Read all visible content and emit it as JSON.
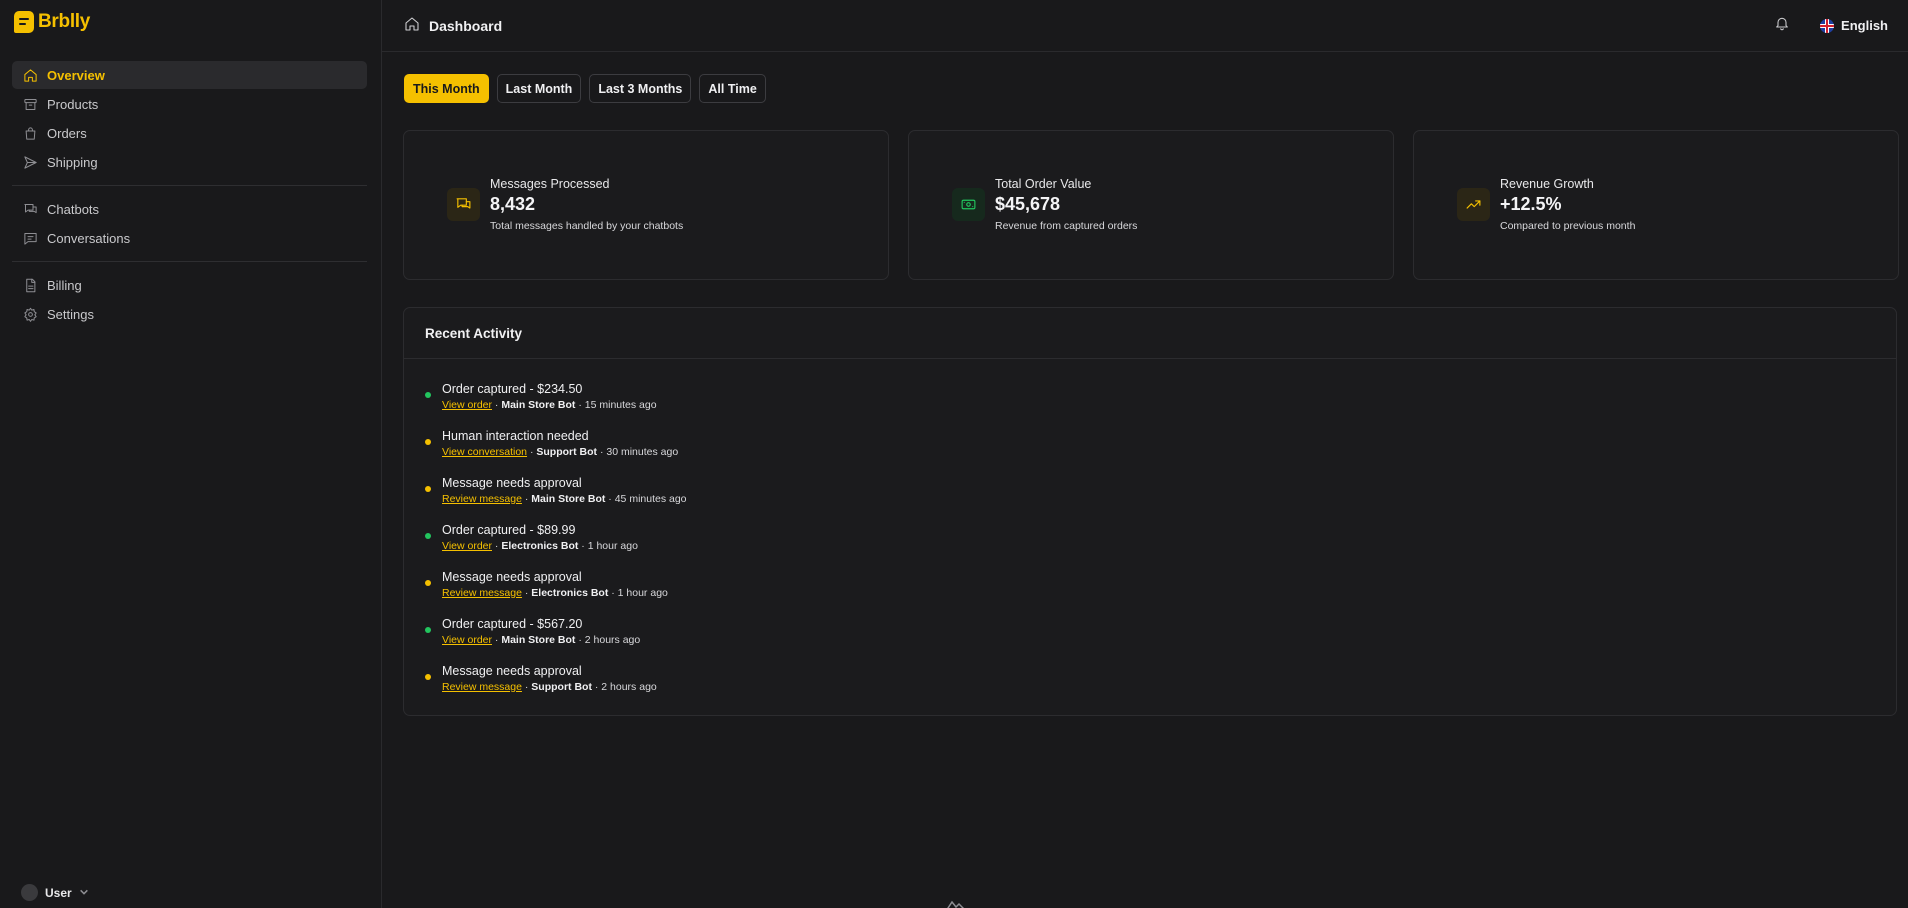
{
  "brand": {
    "name": "Brblly"
  },
  "sidebar": {
    "items": [
      {
        "label": "Overview",
        "icon": "home-icon",
        "active": true
      },
      {
        "label": "Products",
        "icon": "archive-box-icon"
      },
      {
        "label": "Orders",
        "icon": "shopping-bag-icon"
      },
      {
        "label": "Shipping",
        "icon": "send-icon"
      },
      {
        "label": "Chatbots",
        "icon": "chat-bubbles-icon"
      },
      {
        "label": "Conversations",
        "icon": "message-square-icon"
      },
      {
        "label": "Billing",
        "icon": "file-text-icon"
      },
      {
        "label": "Settings",
        "icon": "gear-icon"
      }
    ],
    "user": {
      "label": "User"
    }
  },
  "header": {
    "title": "Dashboard",
    "language": "English"
  },
  "filters": [
    "This Month",
    "Last Month",
    "Last 3 Months",
    "All Time"
  ],
  "stats": [
    {
      "label": "Messages Processed",
      "value": "8,432",
      "sub": "Total messages handled by your chatbots",
      "icon": "chat-bubbles-icon",
      "color": "#f5c000"
    },
    {
      "label": "Total Order Value",
      "value": "$45,678",
      "sub": "Revenue from captured orders",
      "icon": "banknote-icon",
      "color": "#22c55e"
    },
    {
      "label": "Revenue Growth",
      "value": "+12.5%",
      "sub": "Compared to previous month",
      "icon": "trending-up-icon",
      "color": "#f5c000"
    }
  ],
  "activity": {
    "title": "Recent Activity",
    "items": [
      {
        "title": "Order captured - $234.50",
        "link": "View order",
        "bot": "Main Store Bot",
        "time": " · 15 minutes ago",
        "status": "success"
      },
      {
        "title": "Human interaction needed",
        "link": "View conversation",
        "bot": "Support Bot",
        "time": " · 30 minutes ago",
        "status": "warning"
      },
      {
        "title": "Message needs approval",
        "link": "Review message",
        "bot": "Main Store Bot",
        "time": " · 45 minutes ago",
        "status": "warning"
      },
      {
        "title": "Order captured - $89.99",
        "link": "View order",
        "bot": "Electronics Bot",
        "time": " · 1 hour ago",
        "status": "success"
      },
      {
        "title": "Message needs approval",
        "link": "Review message",
        "bot": "Electronics Bot",
        "time": " · 1 hour ago",
        "status": "warning"
      },
      {
        "title": "Order captured - $567.20",
        "link": "View order",
        "bot": "Main Store Bot",
        "time": " · 2 hours ago",
        "status": "success"
      },
      {
        "title": "Message needs approval",
        "link": "Review message",
        "bot": "Support Bot",
        "time": " · 2 hours ago",
        "status": "warning"
      }
    ]
  },
  "colors": {
    "accent": "#f5c000",
    "success": "#22c55e",
    "background": "#19191b"
  }
}
